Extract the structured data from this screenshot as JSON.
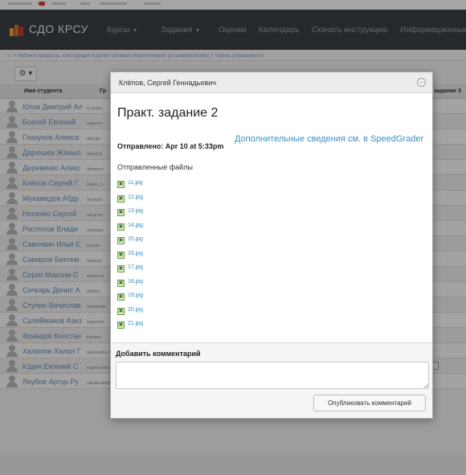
{
  "app": {
    "brand": "СДО КРСУ",
    "nav": [
      {
        "label": "Курсы",
        "caret": "▼"
      },
      {
        "label": "Задания",
        "caret": "▼"
      },
      {
        "label": "Оценки",
        "caret": ""
      },
      {
        "label": "Календарь",
        "caret": ""
      },
      {
        "label": "Скачать инструкцию",
        "caret": ""
      },
      {
        "label": "Информационные",
        "caret": ""
      }
    ]
  },
  "breadcrumb": {
    "path": "Рабочие процессы, конструкция и расчет силовых энергетических установок(онлайн)",
    "sep": ">",
    "current": "Табель успеваемости"
  },
  "toolbar": {
    "gear": "⚙ ▾"
  },
  "grid": {
    "headers": [
      "Имя студента",
      "Гр",
      "задание 3"
    ],
    "students": [
      {
        "name": "Югов Дмитрий Ал",
        "email": "d_yugov_"
      },
      {
        "name": "Боатей Евгений",
        "email": "evgeny.e"
      },
      {
        "name": "Глазунов Алекса",
        "email": "alex.gla"
      },
      {
        "name": "Дарюшев Жаныл",
        "email": "zhanyl.d"
      },
      {
        "name": "Деревенко Алекс",
        "email": "derevenk"
      },
      {
        "name": "Клёпов Сергей Г",
        "email": "klepov_s"
      },
      {
        "name": "Мукамедов Абду",
        "email": "abumam"
      },
      {
        "name": "Носенко Сергей",
        "email": "serge.no"
      },
      {
        "name": "Распопов Влади",
        "email": "raspopov"
      },
      {
        "name": "Савочкин Илья Е",
        "email": "ilya.sav"
      },
      {
        "name": "Самаров Бектем",
        "email": "samarov"
      },
      {
        "name": "Серко Максим С",
        "email": "maxim.se"
      },
      {
        "name": "Сичкарь Денис А",
        "email": "sichkar_"
      },
      {
        "name": "Ступин Вячеслав",
        "email": "viacheslav"
      },
      {
        "name": "Сулейманов Азиз",
        "email": "suleyman"
      },
      {
        "name": "Францов Констан",
        "email": "frantsov"
      },
      {
        "name": "Халилов Халил Г",
        "email": "xalil.khalilov.84@"
      },
      {
        "name": "Юдин Евгений С",
        "email": "eugenyudin@yma"
      },
      {
        "name": "Якубов Артур Ру",
        "email": "yakubovart@yan"
      }
    ],
    "dash": "-"
  },
  "dialog": {
    "title": "Клёпов, Сергей Геннадьевич",
    "close": "○",
    "assignment_title": "Практ. задание 2",
    "sent": "Отправлено: Apr 10 at 5:33pm",
    "speedgrader_link": "Дополнительные сведения см. в SpeedGrader",
    "files_label": "Отправленные файлы",
    "files": [
      "11.jpg",
      "12.jpg",
      "13.jpg",
      "14.jpg",
      "15.jpg",
      "16.jpg",
      "17.jpg",
      "18.jpg",
      "19.jpg",
      "20.jpg",
      "21.jpg"
    ],
    "file_icon": "▣",
    "comment_label": "Добавить комментарий",
    "comment_value": "",
    "publish_button": "Опубликовать комментарий"
  }
}
